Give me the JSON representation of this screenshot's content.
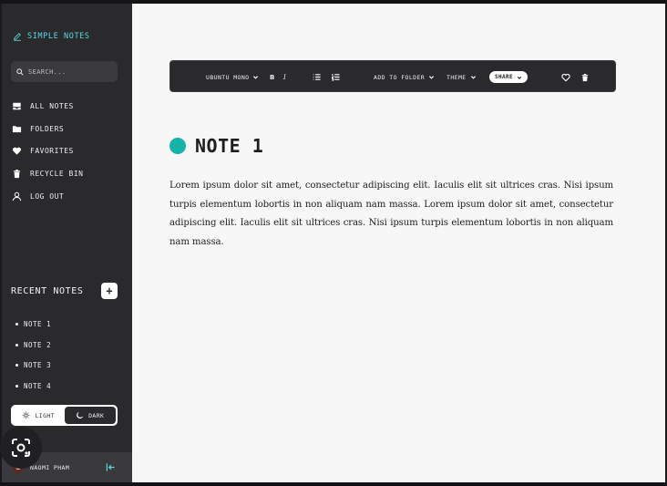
{
  "app": {
    "name": "SIMPLE NOTES"
  },
  "search": {
    "placeholder": "SEARCH..."
  },
  "sidebar": {
    "items": [
      {
        "label": "ALL NOTES",
        "icon": "inbox-icon"
      },
      {
        "label": "FOLDERS",
        "icon": "folder-icon"
      },
      {
        "label": "FAVORITES",
        "icon": "heart-icon"
      },
      {
        "label": "RECYCLE BIN",
        "icon": "trash-icon"
      },
      {
        "label": "LOG OUT",
        "icon": "user-icon"
      }
    ]
  },
  "recent": {
    "title": "RECENT NOTES",
    "add_label": "+",
    "notes": [
      "NOTE 1",
      "NOTE 2",
      "NOTE 3",
      "NOTE 4"
    ]
  },
  "theme_toggle": {
    "light_label": "LIGHT",
    "dark_label": "DARK",
    "selected": "DARK"
  },
  "user": {
    "name": "NAOMI PHAM"
  },
  "toolbar": {
    "font": "UBUNTU MONO",
    "bold": "B",
    "italic": "I",
    "add_to_folder": "ADD TO FOLDER",
    "theme": "THEME",
    "share": "SHARE"
  },
  "note": {
    "title": "NOTE 1",
    "color": "#18b3a8",
    "body": "Lorem ipsum dolor sit amet, consectetur adipiscing elit. Iaculis elit sit ultrices cras. Nisi ipsum turpis elementum lobortis in non aliquam nam massa. Lorem ipsum dolor sit amet, consectetur adipiscing elit. Iaculis elit sit ultrices cras. Nisi ipsum turpis elementum lobortis in non aliquam nam massa."
  },
  "colors": {
    "sidebar_bg": "#2a2a2d",
    "accent": "#5bd6e0",
    "main_bg": "#f7f7f8"
  }
}
